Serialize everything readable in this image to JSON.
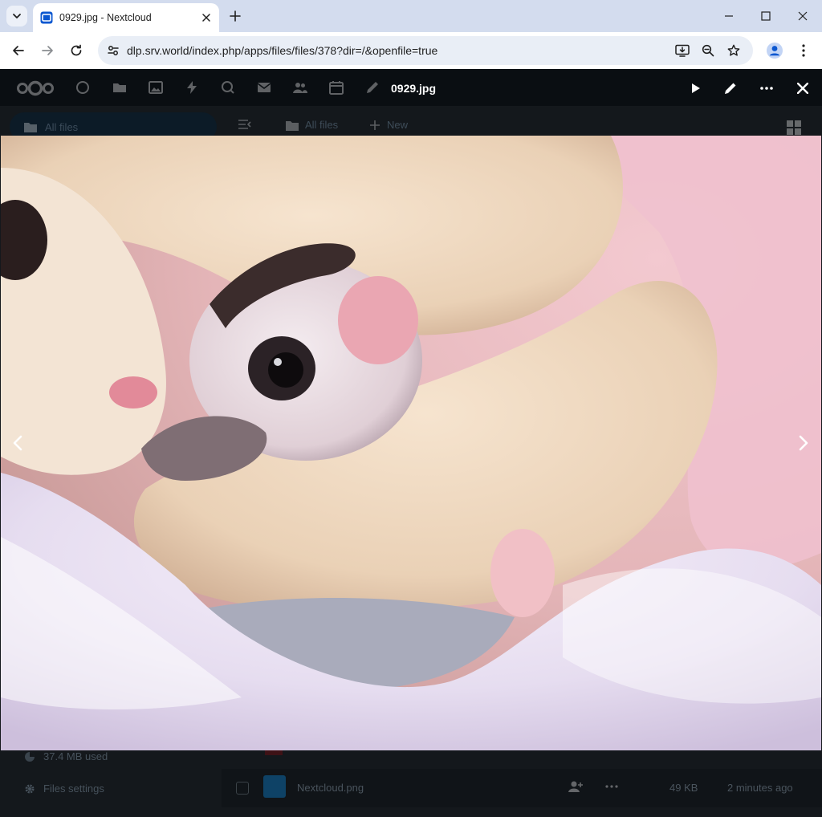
{
  "browser": {
    "tab_title": "0929.jpg - Nextcloud",
    "url": "dlp.srv.world/index.php/apps/files/files/378?dir=/&openfile=true",
    "icons": {
      "tab_search": "chevron-down-icon",
      "favicon": "nextcloud-favicon-icon",
      "tab_close": "close-icon",
      "new_tab": "plus-icon",
      "minimize": "minimize-icon",
      "maximize": "maximize-icon",
      "close_window": "close-icon",
      "back": "arrow-left-icon",
      "forward": "arrow-right-icon",
      "reload": "reload-icon",
      "site_info": "tune-icon",
      "install": "install-app-icon",
      "zoom": "zoom-out-icon",
      "bookmark": "star-icon",
      "profile": "person-icon",
      "menu": "more-vertical-icon"
    }
  },
  "nextcloud": {
    "nav_search": "All files",
    "breadcrumb": "All files",
    "new_label": "New",
    "quota": "37.4 MB used",
    "settings": "Files settings",
    "file_row": {
      "name": "Nextcloud.png",
      "size": "49 KB",
      "modified": "2 minutes ago"
    }
  },
  "viewer": {
    "title": "0929.jpg",
    "icons": {
      "slideshow": "play-icon",
      "edit": "pencil-icon",
      "more": "more-horizontal-icon",
      "close": "close-icon",
      "previous": "chevron-left-icon",
      "next": "chevron-right-icon"
    }
  },
  "colors": {
    "tabstrip": "#d3dcee",
    "omnibox": "#e9eef6",
    "viewer_bg": "#14181c",
    "accent": "#0b57d0"
  }
}
